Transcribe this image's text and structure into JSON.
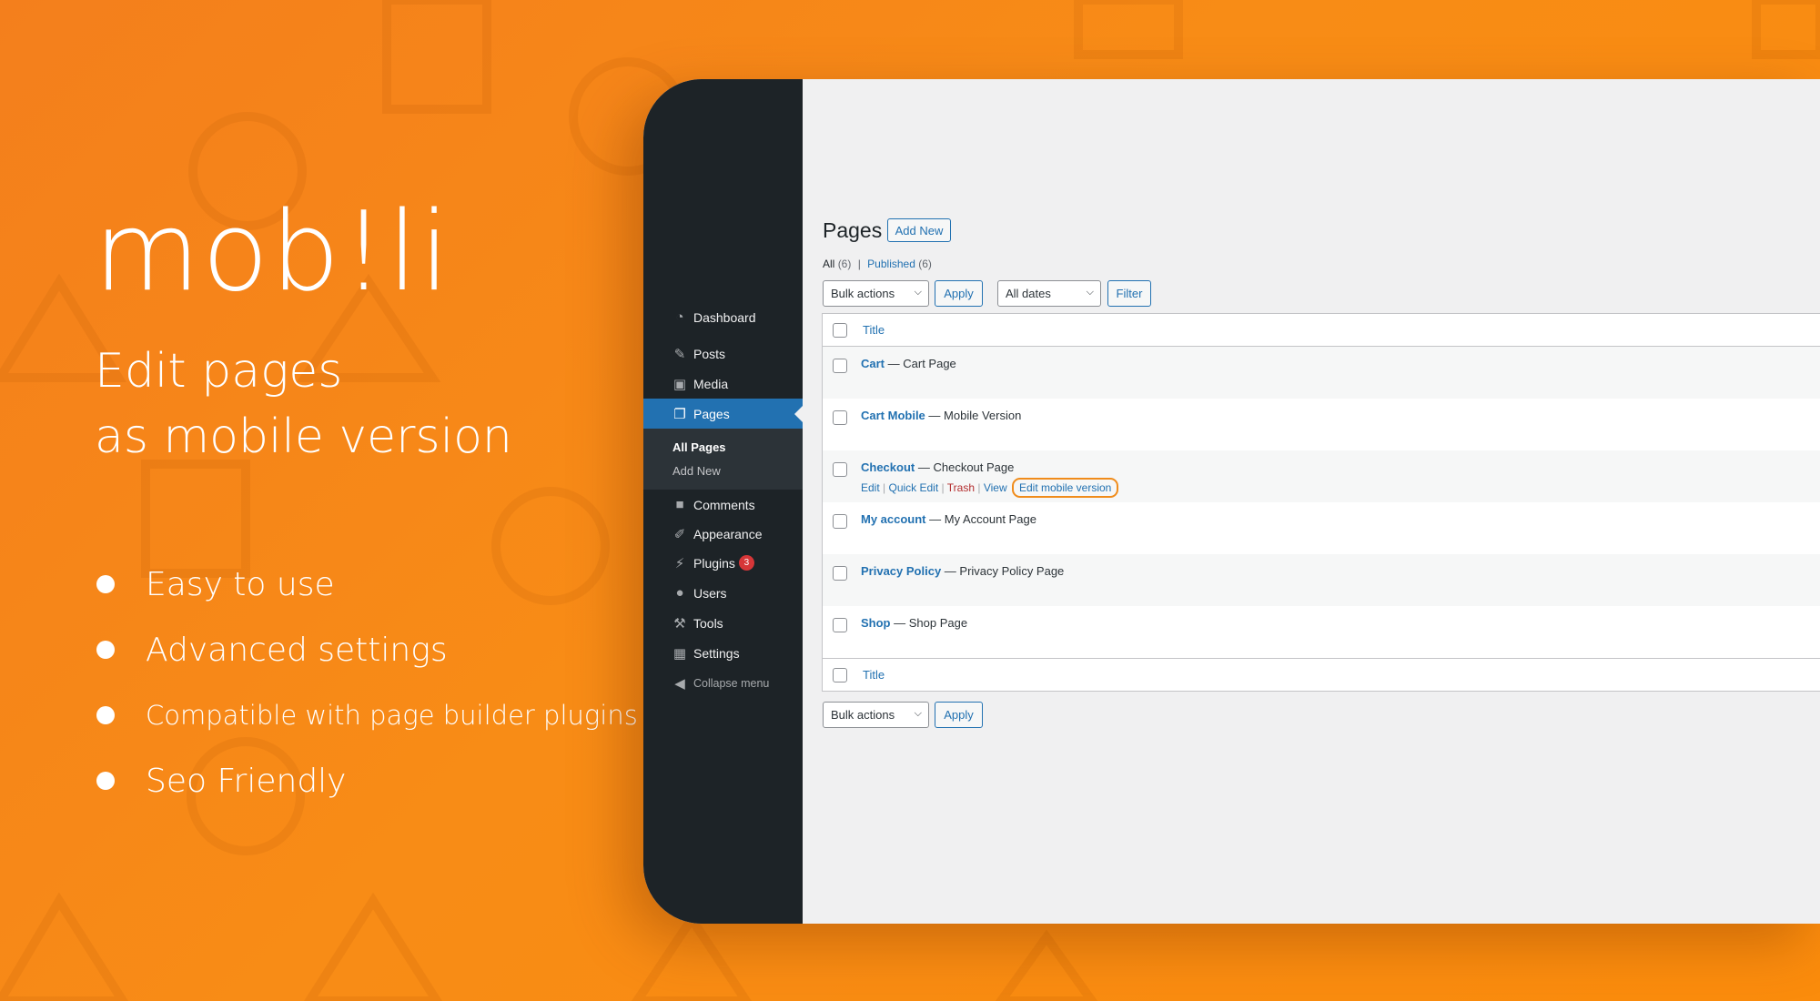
{
  "brand": {
    "logo_text": "mob!li"
  },
  "headline": {
    "line1": "Edit pages",
    "line2": "as mobile version"
  },
  "features": [
    {
      "label": "Easy to use"
    },
    {
      "label": "Advanced settings"
    },
    {
      "label": "Compatible with page builder plugins"
    },
    {
      "label": "Seo Friendly"
    }
  ],
  "wp": {
    "menu": {
      "dashboard": "Dashboard",
      "posts": "Posts",
      "media": "Media",
      "pages": "Pages",
      "all_pages": "All Pages",
      "add_new": "Add New",
      "comments": "Comments",
      "appearance": "Appearance",
      "plugins": "Plugins",
      "plugins_badge": "3",
      "users": "Users",
      "tools": "Tools",
      "settings": "Settings",
      "collapse": "Collapse menu"
    },
    "page_title": "Pages",
    "add_new_button": "Add New",
    "filters": {
      "all": "All",
      "all_count": "(6)",
      "separator": "|",
      "published": "Published",
      "published_count": "(6)"
    },
    "bulk_actions": "Bulk actions",
    "apply": "Apply",
    "all_dates": "All dates",
    "filter": "Filter",
    "column_title": "Title",
    "rows": [
      {
        "title": "Cart",
        "state": "— Cart Page"
      },
      {
        "title": "Cart Mobile",
        "state": "— Mobile Version"
      },
      {
        "title": "Checkout",
        "state": "— Checkout Page"
      },
      {
        "title": "My account",
        "state": "— My Account Page"
      },
      {
        "title": "Privacy Policy",
        "state": "— Privacy Policy Page"
      },
      {
        "title": "Shop",
        "state": "— Shop Page"
      }
    ],
    "row_actions": {
      "edit": "Edit",
      "quick_edit": "Quick Edit",
      "trash": "Trash",
      "view": "View",
      "edit_mobile": "Edit mobile version",
      "sep": "|"
    },
    "colors": {
      "admin_bar": "#1d2327",
      "accent": "#2271b1",
      "highlight": "#f08c1b",
      "brand_orange": "#f88c16"
    }
  }
}
